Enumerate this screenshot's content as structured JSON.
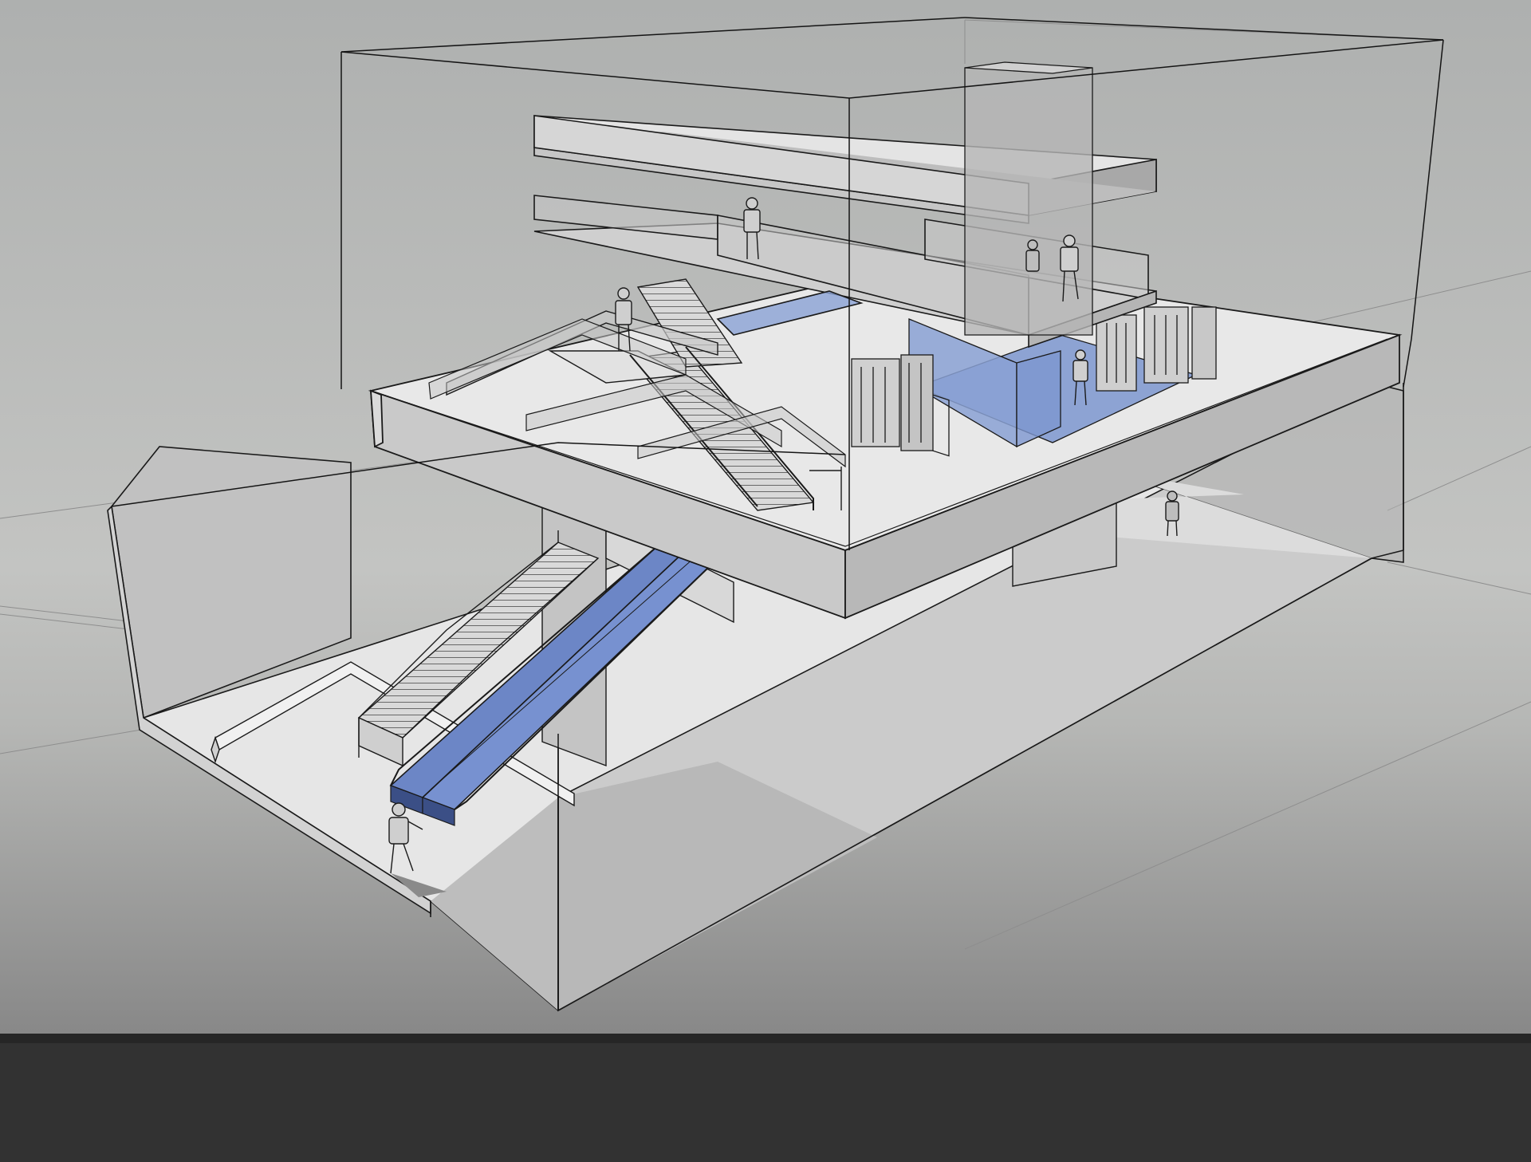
{
  "scene": {
    "type": "3d-sketch-model",
    "subject": "station-entrance-with-escalator-stairs-and-turnstiles",
    "colors": {
      "background_top": "#b9bbba",
      "background_bottom": "#8c8c8c",
      "slab_face": "#d4d4d4",
      "slab_side": "#b8b8b8",
      "floor": "#e9e9e9",
      "glass_blue": "#7d96cf",
      "escalator_blue": "#6c86c6",
      "line": "#1a1a1a",
      "construction_line": "#8a8a8a",
      "bottom_bar": "#323232"
    },
    "icons": [
      "person-figure-icon",
      "turnstile-icon",
      "escalator-icon",
      "stair-icon"
    ]
  }
}
